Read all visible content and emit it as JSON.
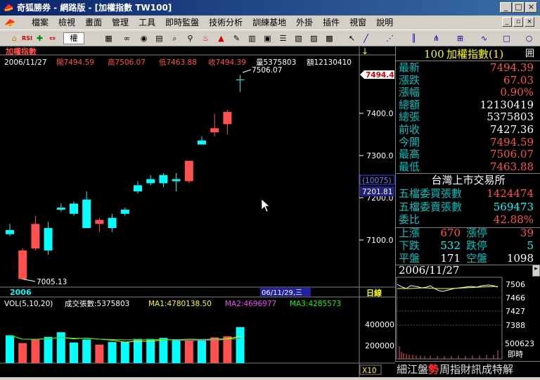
{
  "window": {
    "title": "奇狐勝券 - 網路版 - [加權指數 TW100]",
    "min_label": "_",
    "max_label": "□",
    "close_label": "×"
  },
  "menu": {
    "items": [
      "檔案",
      "檢視",
      "畫面",
      "管理",
      "工具",
      "即時監盤",
      "技術分析",
      "訓練基地",
      "外掛",
      "插件",
      "視窗",
      "說明"
    ]
  },
  "toolbar": {
    "icons": [
      "home-icon",
      "rsi-icon",
      "crosshair-icon",
      "arrows-icon",
      "period-select",
      "blocks-icon",
      "circles-icon",
      "eye-icon",
      "book-icon",
      "search-icon",
      "find-icon",
      "alarm-icon",
      "pen-icon",
      "grid-icon",
      "table-icon",
      "news-icon",
      "chart-icon",
      "chart2-icon",
      "pointer-icon",
      "line-icon",
      "lines-icon",
      "bars-icon",
      "fan-icon",
      "grid2-icon",
      "wave-icon",
      "rect-icon",
      "circle-icon"
    ],
    "period_label": "權",
    "rsi_label": "RSI"
  },
  "chart": {
    "name": "加權指數",
    "date": "2006/11/27",
    "open_label": "開7494.59",
    "high_label": "高7506.07",
    "low_label": "低7463.88",
    "close_label": "收7494.39",
    "vol_label": "量5375803",
    "amount_label": "額12130410",
    "max_mark": "7506.07",
    "min_mark": "7005.13",
    "current_tag": "7494.4",
    "cursor_count": "(10075)",
    "cursor_price": "7201.81",
    "y_ticks": [
      "7400.0",
      "7300.0",
      "7200.0",
      "7100.0"
    ],
    "x_year": "2006",
    "x_cursor": "06/11/29,三",
    "period_tag": "日線",
    "vol_ticks": [
      "400000",
      "200000"
    ],
    "vol_unit": "X10",
    "vol_legend": {
      "params": "VOL(5,10,20)",
      "main": "成交張數:5375803",
      "ma1": "MA1:4780138.50",
      "ma2": "MA2:4696977",
      "ma3": "MA3:4285573"
    },
    "anchor_icon": "↓",
    "colors": {
      "up": "#ff5050",
      "down": "#00ffff",
      "ma1": "#ffff00",
      "ma2": "#ff40ff",
      "ma3": "#00ff00"
    }
  },
  "chart_data": {
    "type": "candlestick",
    "title": "加權指數",
    "candles": [
      {
        "o": 7125,
        "h": 7140,
        "l": 7110,
        "c": 7115
      },
      {
        "o": 7005,
        "h": 7080,
        "l": 7005,
        "c": 7075
      },
      {
        "o": 7080,
        "h": 7160,
        "l": 7075,
        "c": 7140
      },
      {
        "o": 7130,
        "h": 7145,
        "l": 7065,
        "c": 7075
      },
      {
        "o": 7180,
        "h": 7190,
        "l": 7170,
        "c": 7175
      },
      {
        "o": 7190,
        "h": 7195,
        "l": 7160,
        "c": 7165
      },
      {
        "o": 7200,
        "h": 7220,
        "l": 7130,
        "c": 7130
      },
      {
        "o": 7140,
        "h": 7155,
        "l": 7120,
        "c": 7150
      },
      {
        "o": 7155,
        "h": 7165,
        "l": 7120,
        "c": 7130
      },
      {
        "o": 7175,
        "h": 7180,
        "l": 7160,
        "c": 7165
      },
      {
        "o": 7235,
        "h": 7245,
        "l": 7215,
        "c": 7220
      },
      {
        "o": 7250,
        "h": 7260,
        "l": 7235,
        "c": 7240
      },
      {
        "o": 7260,
        "h": 7265,
        "l": 7230,
        "c": 7240
      },
      {
        "o": 7250,
        "h": 7265,
        "l": 7220,
        "c": 7245
      },
      {
        "o": 7245,
        "h": 7295,
        "l": 7240,
        "c": 7295
      },
      {
        "o": 7345,
        "h": 7355,
        "l": 7335,
        "c": 7335
      },
      {
        "o": 7365,
        "h": 7410,
        "l": 7355,
        "c": 7375
      },
      {
        "o": 7385,
        "h": 7420,
        "l": 7360,
        "c": 7415
      },
      {
        "o": 7494.59,
        "h": 7506.07,
        "l": 7463.88,
        "c": 7494.39
      }
    ],
    "volume": [
      270,
      195,
      230,
      255,
      300,
      200,
      230,
      180,
      205,
      205,
      235,
      235,
      245,
      225,
      220,
      225,
      250,
      260,
      350
    ],
    "ylim": [
      6985,
      7555
    ],
    "vol_ylim": [
      0,
      520
    ]
  },
  "quote": {
    "code": "100",
    "name": "加權指數(1)",
    "menu_icon": "囲",
    "rows": [
      {
        "label": "最新",
        "value": "7494.39",
        "color": "#ff5050"
      },
      {
        "label": "漲跌",
        "value": "67.03",
        "color": "#ff5050"
      },
      {
        "label": "漲幅",
        "value": "0.90%",
        "color": "#ff5050"
      },
      {
        "label": "總額",
        "value": "12130419",
        "color": "#ffffff"
      },
      {
        "label": "總張",
        "value": "5375803",
        "color": "#ffffff"
      },
      {
        "label": "前收",
        "value": "7427.36",
        "color": "#ffffff"
      },
      {
        "label": "今開",
        "value": "7494.59",
        "color": "#ff5050"
      },
      {
        "label": "最高",
        "value": "7506.07",
        "color": "#ff5050"
      },
      {
        "label": "最低",
        "value": "7463.88",
        "color": "#ff5050"
      }
    ],
    "exchange": "台灣上市交易所",
    "rows2": [
      {
        "label": "五檔委買張數",
        "value": "1424474",
        "color": "#ff5050"
      },
      {
        "label": "五檔委賣張數",
        "value": "569473",
        "color": "#00ffff"
      },
      {
        "label": "委比",
        "value": "42.88%",
        "color": "#ff5050"
      }
    ],
    "stats": [
      {
        "l1": "上漲",
        "v1": "670",
        "l2": "漲停",
        "v2": "39",
        "c": "#ff5050"
      },
      {
        "l1": "下跌",
        "v1": "532",
        "l2": "跌停",
        "v2": "5",
        "c": "#00ffff"
      },
      {
        "l1": "平盤",
        "v1": "171",
        "l2": "空盤",
        "v2": "1098",
        "c": "#ffffff"
      }
    ],
    "mini_date": "2006/11/27",
    "mini_ticks": [
      "7506",
      "7466",
      "7427",
      "7388"
    ],
    "mini_vol": "500623",
    "mini_realtime": "即時",
    "bottom_pre": "細江盤",
    "bottom_hl": "勢",
    "bottom_post": "周指財訊成特解"
  }
}
